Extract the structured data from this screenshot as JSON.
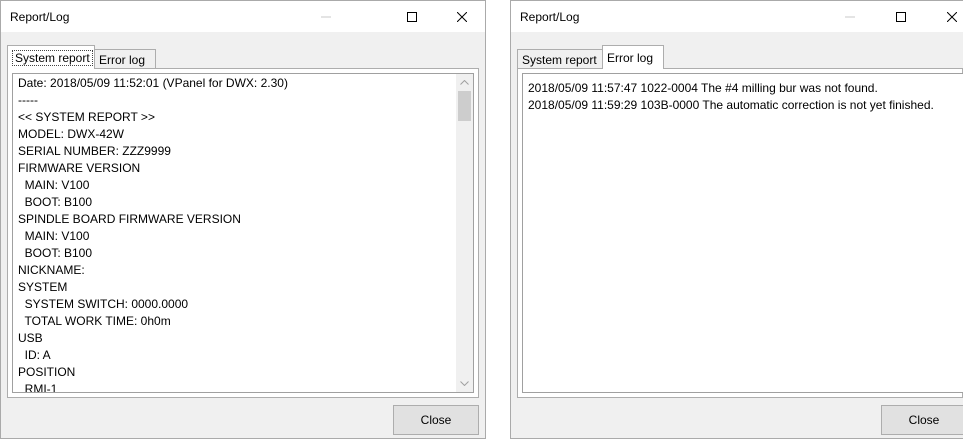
{
  "window1": {
    "title": "Report/Log",
    "tabs": [
      {
        "label": "System report",
        "active": true
      },
      {
        "label": "Error log",
        "active": false
      }
    ],
    "lines": [
      "Date: 2018/05/09 11:52:01 (VPanel for DWX: 2.30)",
      "-----",
      "<< SYSTEM REPORT >>",
      "MODEL: DWX-42W",
      "SERIAL NUMBER: ZZZ9999",
      "FIRMWARE VERSION",
      "  MAIN: V100",
      "  BOOT: B100",
      "SPINDLE BOARD FIRMWARE VERSION",
      "  MAIN: V100",
      "  BOOT: B100",
      "NICKNAME:",
      "SYSTEM",
      "  SYSTEM SWITCH: 0000.0000",
      "  TOTAL WORK TIME: 0h0m",
      "USB",
      "  ID: A",
      "POSITION",
      "  RMI-1"
    ],
    "close_label": "Close"
  },
  "window2": {
    "title": "Report/Log",
    "tabs": [
      {
        "label": "System report",
        "active": false
      },
      {
        "label": "Error log",
        "active": true
      }
    ],
    "lines": [
      "2018/05/09 11:57:47 1022-0004 The #4 milling bur was not found.",
      "2018/05/09 11:59:29 103B-0000 The automatic correction is not yet finished."
    ],
    "close_label": "Close"
  },
  "colors": {
    "window_bg": "#f0f0f0",
    "titlebar_bg": "#ffffff",
    "border": "#adadad",
    "button_bg": "#e1e1e1",
    "scroll_thumb": "#cdcdcd"
  },
  "icons": [
    "minimize-icon",
    "maximize-icon",
    "close-icon",
    "scroll-up-arrow-icon",
    "scroll-down-arrow-icon"
  ]
}
